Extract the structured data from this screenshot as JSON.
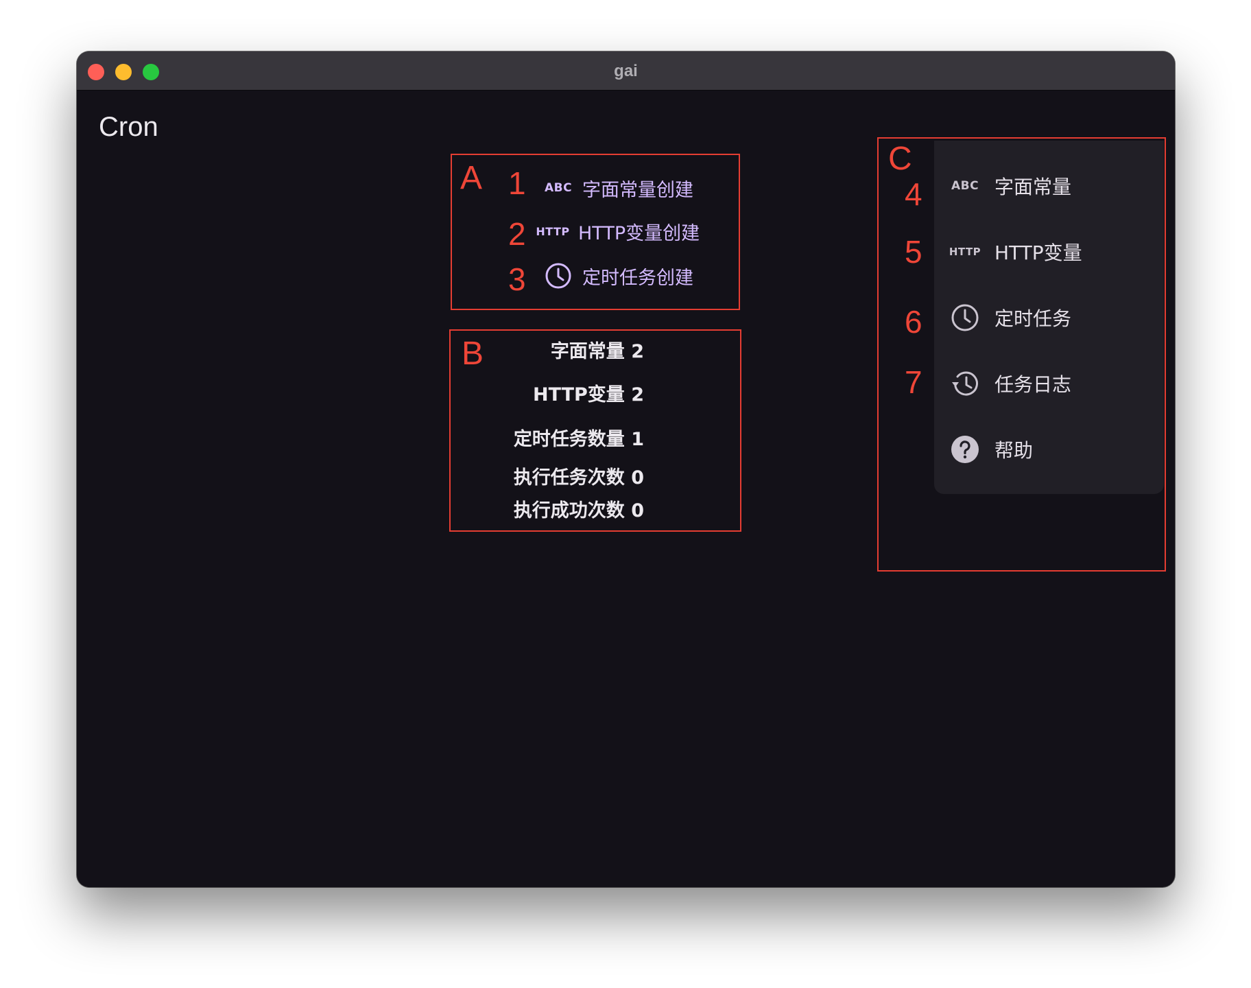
{
  "window": {
    "title": "gai"
  },
  "page": {
    "title": "Cron"
  },
  "annotations": {
    "box_a": "A",
    "box_b": "B",
    "box_c": "C",
    "numbers": [
      "1",
      "2",
      "3",
      "4",
      "5",
      "6",
      "7"
    ]
  },
  "quick_create": {
    "items": [
      {
        "label": "字面常量创建",
        "icon": "ABC",
        "icon_name": "abc-icon"
      },
      {
        "label": "HTTP变量创建",
        "icon": "HTTP",
        "icon_name": "http-icon"
      },
      {
        "label": "定时任务创建",
        "icon": "",
        "icon_name": "clock-icon"
      }
    ]
  },
  "stats": {
    "lines": [
      "字面常量 2",
      "HTTP变量 2",
      "定时任务数量 1",
      "执行任务次数 0",
      "执行成功次数 0"
    ]
  },
  "nav_rail": {
    "items": [
      {
        "label": "字面常量",
        "icon": "ABC",
        "icon_name": "abc-icon"
      },
      {
        "label": "HTTP变量",
        "icon": "HTTP",
        "icon_name": "http-icon"
      },
      {
        "label": "定时任务",
        "icon": "",
        "icon_name": "clock-icon"
      },
      {
        "label": "任务日志",
        "icon": "",
        "icon_name": "history-icon"
      },
      {
        "label": "帮助",
        "icon": "",
        "icon_name": "help-icon"
      }
    ]
  },
  "colors": {
    "background": "#131118",
    "titlebar": "#38363c",
    "accent_text": "#d4bbff",
    "rail_background": "#211f26",
    "annotation_red": "#e53d32"
  }
}
